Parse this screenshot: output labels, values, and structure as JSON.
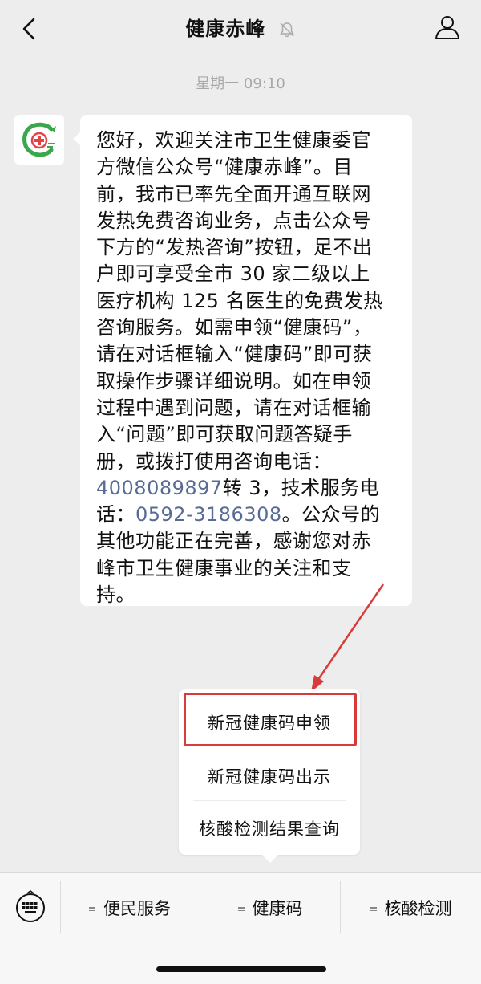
{
  "header": {
    "title": "健康赤峰",
    "back_icon": "chevron-left-icon",
    "mute_icon": "bell-off-icon",
    "profile_icon": "person-icon"
  },
  "timestamp": "星期一 09:10",
  "message": {
    "avatar_icon": "health-logo-icon",
    "lines": [
      "您好，欢迎关注市卫生健康委官",
      "方微信公众号“健康赤峰”。目",
      "前，我市已率先全面开通互联网",
      "发热免费咨询业务，点击公众号",
      "下方的“发热咨询”按钮，足不出",
      "户即可享受全市 30 家二级以上",
      "医疗机构 125 名医生的免费发热",
      "咨询服务。如需申领“健康码”，",
      "请在对话框输入“健康码”即可获",
      "取操作步骤详细说明。如在申领",
      "过程中遇到问题，请在对话框输",
      "入“问题”即可获取问题答疑手",
      "册，或拨打使用咨询电话："
    ],
    "phone1": "4008089897",
    "line14_rest": "转 3，技术服务电",
    "line15_prefix": "话：",
    "phone2": "0592-3186308",
    "line15_rest": "。公众号的",
    "lines_end": [
      "其他功能正在完善，感谢您对赤",
      "峰市卫生健康事业的关注和支",
      "持。"
    ]
  },
  "popup_menu": {
    "items": [
      "新冠健康码申领",
      "新冠健康码出示",
      "核酸检测结果查询"
    ],
    "highlighted_index": 0,
    "highlight_color": "#d93a3a"
  },
  "bottom_menu": {
    "keyboard_icon": "keyboard-icon",
    "tabs": [
      "便民服务",
      "健康码",
      "核酸检测"
    ]
  },
  "colors": {
    "link": "#576b95",
    "annotation_red": "#d93a3a",
    "background": "#ededed"
  }
}
